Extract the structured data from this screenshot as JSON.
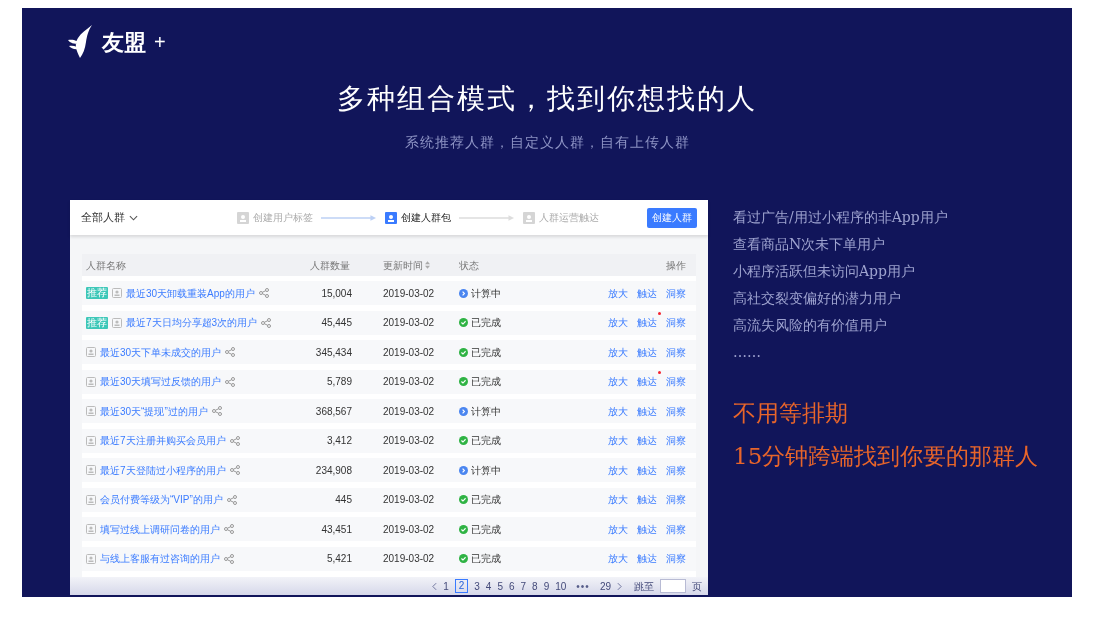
{
  "logo": {
    "text": "友盟",
    "plus": "+"
  },
  "headline": "多种组合模式，找到你想找的人",
  "subheadline": "系统推荐人群，自定义人群，自有上传人群",
  "app": {
    "scope": "全部人群",
    "steps": [
      {
        "label": "创建用户标签",
        "selected": false
      },
      {
        "label": "创建人群包",
        "selected": true
      },
      {
        "label": "人群运营触达",
        "selected": false
      }
    ],
    "create_button": "创建人群",
    "columns": [
      "人群名称",
      "人群数量",
      "更新时间",
      "状态",
      "操作"
    ],
    "rows": [
      {
        "tag": "推荐",
        "name": "最近30天卸载重装App的用户",
        "count": "15,004",
        "date": "2019-03-02",
        "status": {
          "kind": "computing",
          "label": "计算中"
        },
        "actions": [
          "放大",
          "触达",
          "洞察"
        ],
        "alert": false
      },
      {
        "tag": "推荐",
        "name": "最近7天日均分享超3次的用户",
        "count": "45,445",
        "date": "2019-03-02",
        "status": {
          "kind": "done",
          "label": "已完成"
        },
        "actions": [
          "放大",
          "触达",
          "洞察"
        ],
        "alert": true
      },
      {
        "name": "最近30天下单未成交的用户",
        "count": "345,434",
        "date": "2019-03-02",
        "status": {
          "kind": "done",
          "label": "已完成"
        },
        "actions": [
          "放大",
          "触达",
          "洞察"
        ],
        "alert": false
      },
      {
        "name": "最近30天填写过反馈的用户",
        "count": "5,789",
        "date": "2019-03-02",
        "status": {
          "kind": "done",
          "label": "已完成"
        },
        "actions": [
          "放大",
          "触达",
          "洞察"
        ],
        "alert": true
      },
      {
        "name": "最近30天“提现”过的用户",
        "count": "368,567",
        "date": "2019-03-02",
        "status": {
          "kind": "computing",
          "label": "计算中"
        },
        "actions": [
          "放大",
          "触达",
          "洞察"
        ],
        "alert": false
      },
      {
        "name": "最近7天注册并购买会员用户",
        "count": "3,412",
        "date": "2019-03-02",
        "status": {
          "kind": "done",
          "label": "已完成"
        },
        "actions": [
          "放大",
          "触达",
          "洞察"
        ],
        "alert": false
      },
      {
        "name": "最近7天登陆过小程序的用户",
        "count": "234,908",
        "date": "2019-03-02",
        "status": {
          "kind": "computing",
          "label": "计算中"
        },
        "actions": [
          "放大",
          "触达",
          "洞察"
        ],
        "alert": false
      },
      {
        "name": "会员付费等级为“VIP”的用户",
        "count": "445",
        "date": "2019-03-02",
        "status": {
          "kind": "done",
          "label": "已完成"
        },
        "actions": [
          "放大",
          "触达",
          "洞察"
        ],
        "alert": false
      },
      {
        "name": "填写过线上调研问卷的用户",
        "count": "43,451",
        "date": "2019-03-02",
        "status": {
          "kind": "done",
          "label": "已完成"
        },
        "actions": [
          "放大",
          "触达",
          "洞察"
        ],
        "alert": false
      },
      {
        "name": "与线上客服有过咨询的用户",
        "count": "5,421",
        "date": "2019-03-02",
        "status": {
          "kind": "done",
          "label": "已完成"
        },
        "actions": [
          "放大",
          "触达",
          "洞察"
        ],
        "alert": false
      }
    ],
    "pagination": {
      "pages": [
        {
          "label": "1",
          "selected": false
        },
        {
          "label": "2",
          "selected": true
        },
        {
          "label": "3",
          "selected": false
        },
        {
          "label": "4",
          "selected": false
        },
        {
          "label": "5",
          "selected": false
        },
        {
          "label": "6",
          "selected": false
        },
        {
          "label": "7",
          "selected": false
        },
        {
          "label": "8",
          "selected": false
        },
        {
          "label": "9",
          "selected": false
        },
        {
          "label": "10",
          "selected": false
        }
      ],
      "gap": "•••",
      "last": "29",
      "jump_label": "跳至",
      "page_suffix": "页"
    }
  },
  "segments": [
    "看过广告/用过小程序的非App用户",
    "查看商品N次未下单用户",
    "小程序活跃但未访问App用户",
    "高社交裂变偏好的潜力用户",
    "高流失风险的有价值用户",
    "……"
  ],
  "highlights": [
    "不用等排期",
    "15分钟跨端找到你要的那群人"
  ]
}
